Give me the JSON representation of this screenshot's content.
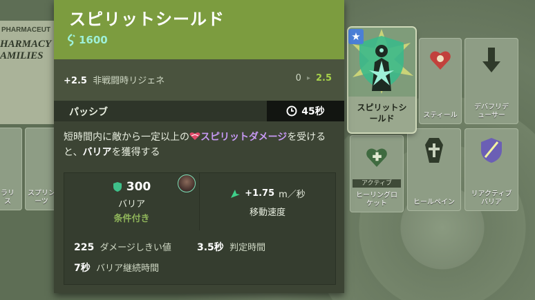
{
  "tooltip": {
    "title": "スピリットシールド",
    "cost": "1600",
    "regen": {
      "prefix": "+2.5",
      "label": "非戦闘時リジェネ",
      "from": "0",
      "to": "2.5"
    },
    "passive_label": "パッシブ",
    "cooldown": "45秒",
    "description": {
      "part1": "短時間内に敵から一定以上の",
      "spirit_damage": "スピリットダメージ",
      "part2": "を受けると、",
      "barrier": "バリア",
      "part3": "を獲得する"
    },
    "stat_barrier": {
      "value": "300",
      "label": "バリア",
      "condition": "条件付き"
    },
    "stat_move": {
      "value": "+1.75",
      "unit": "m／秒",
      "label": "移動速度"
    },
    "lower_stats": [
      {
        "value": "225",
        "label": "ダメージしきい値"
      },
      {
        "value": "3.5秒",
        "label": "判定時間"
      },
      {
        "value": "7秒",
        "label": "バリア継続時間"
      }
    ]
  },
  "background": {
    "paper_label": "PHARMACEUT",
    "paper_text": "HARMACY\nAMILIES",
    "selected_item": "スピリットシ\nールド",
    "tiles": [
      {
        "label": "スティール"
      },
      {
        "label": "デバフリデ\nューサー"
      },
      {
        "label": "ヒーリングロ\nケット",
        "tag": "アクティブ"
      },
      {
        "label": "ヒールペイン"
      },
      {
        "label": "リアクティブ\nバリア"
      },
      {
        "label": "ラリ\nス"
      },
      {
        "label": "スプリン\nーツ"
      }
    ]
  },
  "colors": {
    "header": "#7c9c3f",
    "spirit": "#c799f5",
    "souls": "#9ef0d8",
    "buff": "#a6d14a"
  }
}
